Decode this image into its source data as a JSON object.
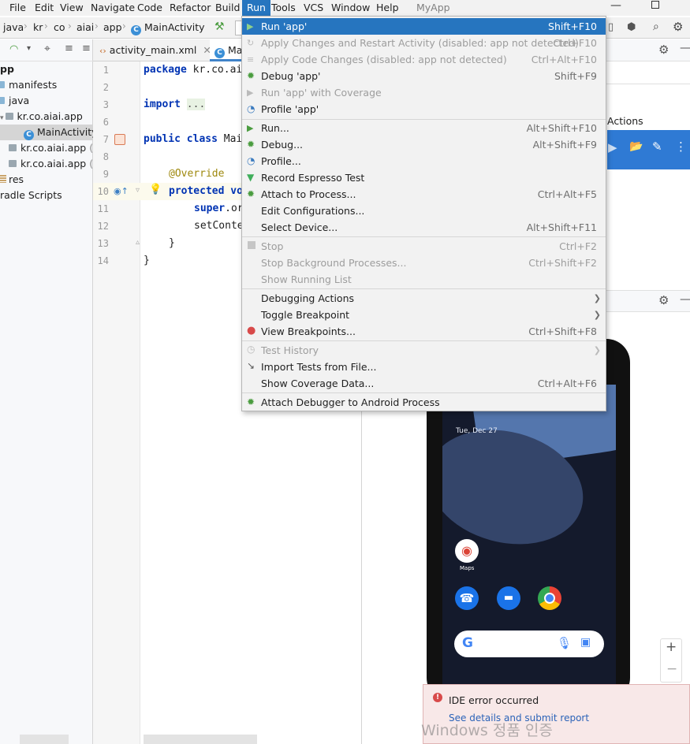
{
  "menubar": {
    "items": [
      "File",
      "Edit",
      "View",
      "Navigate",
      "Code",
      "Refactor",
      "Build",
      "Run",
      "Tools",
      "VCS",
      "Window",
      "Help"
    ],
    "project": "MyApp",
    "active": "Run"
  },
  "breadcrumb": [
    "java",
    "kr",
    "co",
    "aiai",
    "app",
    "MainActivity"
  ],
  "project_tree": [
    {
      "label": "pp",
      "suffix": ""
    },
    {
      "label": "manifests",
      "suffix": ""
    },
    {
      "label": "java",
      "suffix": ""
    },
    {
      "label": "kr.co.aiai.app",
      "suffix": ""
    },
    {
      "label": "MainActivity",
      "suffix": ""
    },
    {
      "label": "kr.co.aiai.app",
      "suffix": "(ar"
    },
    {
      "label": "kr.co.aiai.app",
      "suffix": "(te"
    },
    {
      "label": "res",
      "suffix": ""
    },
    {
      "label": "radle Scripts",
      "suffix": ""
    }
  ],
  "editor": {
    "tabs": [
      "activity_main.xml",
      "Ma"
    ],
    "line_numbers": [
      "1",
      "2",
      "3",
      "6",
      "7",
      "8",
      "9",
      "10",
      "11",
      "12",
      "13",
      "14"
    ],
    "code": {
      "l1_kw": "package",
      "l1_rest": " kr.co.ai",
      "l3_kw": "import",
      "l3_fold": "...",
      "l7_kw": "public class",
      "l7_rest": " Mai",
      "l9_ann": "@Override",
      "l10_kw": "protected",
      "l10_rest": " vo",
      "l11_kw": "super",
      "l11_rest": ".or",
      "l12": "setConte",
      "l13": "}",
      "l14": "}"
    }
  },
  "right_panel": {
    "actions_label": "Actions"
  },
  "emulator": {
    "date": "Tue, Dec 27",
    "maps_label": "Maps"
  },
  "run_menu": {
    "items": [
      {
        "label": "Run 'app'",
        "shortcut": "Shift+F10",
        "selected": true,
        "disabled": false
      },
      {
        "label": "Apply Changes and Restart Activity (disabled: app not detected)",
        "shortcut": "Ctrl+F10",
        "disabled": true
      },
      {
        "label": "Apply Code Changes (disabled: app not detected)",
        "shortcut": "Ctrl+Alt+F10",
        "disabled": true
      },
      {
        "label": "Debug 'app'",
        "shortcut": "Shift+F9",
        "disabled": false
      },
      {
        "label": "Run 'app' with Coverage",
        "shortcut": "",
        "disabled": true
      },
      {
        "label": "Profile 'app'",
        "shortcut": "",
        "disabled": false
      },
      {
        "label": "Run...",
        "shortcut": "Alt+Shift+F10",
        "disabled": false
      },
      {
        "label": "Debug...",
        "shortcut": "Alt+Shift+F9",
        "disabled": false
      },
      {
        "label": "Profile...",
        "shortcut": "",
        "disabled": false
      },
      {
        "label": "Record Espresso Test",
        "shortcut": "",
        "disabled": false
      },
      {
        "label": "Attach to Process...",
        "shortcut": "Ctrl+Alt+F5",
        "disabled": false
      },
      {
        "label": "Edit Configurations...",
        "shortcut": "",
        "disabled": false
      },
      {
        "label": "Select Device...",
        "shortcut": "Alt+Shift+F11",
        "disabled": false
      },
      {
        "label": "Stop",
        "shortcut": "Ctrl+F2",
        "disabled": true
      },
      {
        "label": "Stop Background Processes...",
        "shortcut": "Ctrl+Shift+F2",
        "disabled": true
      },
      {
        "label": "Show Running List",
        "shortcut": "",
        "disabled": true
      },
      {
        "label": "Debugging Actions",
        "shortcut": "",
        "disabled": false,
        "submenu": true
      },
      {
        "label": "Toggle Breakpoint",
        "shortcut": "",
        "disabled": false,
        "submenu": true
      },
      {
        "label": "View Breakpoints...",
        "shortcut": "Ctrl+Shift+F8",
        "disabled": false
      },
      {
        "label": "Test History",
        "shortcut": "",
        "disabled": true,
        "submenu": true
      },
      {
        "label": "Import Tests from File...",
        "shortcut": "",
        "disabled": false
      },
      {
        "label": "Show Coverage Data...",
        "shortcut": "Ctrl+Alt+F6",
        "disabled": false
      },
      {
        "label": "Attach Debugger to Android Process",
        "shortcut": "",
        "disabled": false
      }
    ]
  },
  "toast": {
    "title": "IDE error occurred",
    "link": "See details and submit report"
  },
  "watermark": {
    "line1": "Windows 정품 인증"
  },
  "colors": {
    "accent": "#2675bf",
    "run_green": "#4a9c3f",
    "error_red": "#d84a4a"
  }
}
